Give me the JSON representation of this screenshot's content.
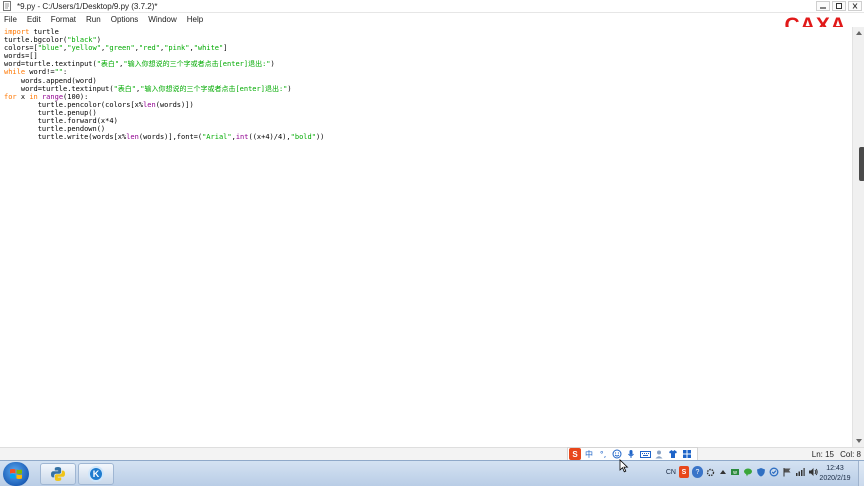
{
  "window": {
    "title": "*9.py - C:/Users/1/Desktop/9.py (3.7.2)*"
  },
  "menu": {
    "items": [
      "File",
      "Edit",
      "Format",
      "Run",
      "Options",
      "Window",
      "Help"
    ]
  },
  "overlay": {
    "logo_text": "CAXA",
    "logo_color": "#e11919"
  },
  "editor": {
    "lines": [
      [
        {
          "t": "import",
          "c": "kw"
        },
        {
          "t": " turtle",
          "c": ""
        }
      ],
      [
        {
          "t": "turtle.bgcolor(",
          "c": ""
        },
        {
          "t": "\"black\"",
          "c": "str"
        },
        {
          "t": ")",
          "c": ""
        }
      ],
      [
        {
          "t": "colors=[",
          "c": ""
        },
        {
          "t": "\"blue\"",
          "c": "str"
        },
        {
          "t": ",",
          "c": ""
        },
        {
          "t": "\"yellow\"",
          "c": "str"
        },
        {
          "t": ",",
          "c": ""
        },
        {
          "t": "\"green\"",
          "c": "str"
        },
        {
          "t": ",",
          "c": ""
        },
        {
          "t": "\"red\"",
          "c": "str"
        },
        {
          "t": ",",
          "c": ""
        },
        {
          "t": "\"pink\"",
          "c": "str"
        },
        {
          "t": ",",
          "c": ""
        },
        {
          "t": "\"white\"",
          "c": "str"
        },
        {
          "t": "]",
          "c": ""
        }
      ],
      [
        {
          "t": "words=[]",
          "c": ""
        }
      ],
      [
        {
          "t": "word=turtle.textinput(",
          "c": ""
        },
        {
          "t": "\"表白\"",
          "c": "str"
        },
        {
          "t": ",",
          "c": ""
        },
        {
          "t": "\"输入你想说的三个字或者点击[enter]退出:\"",
          "c": "str"
        },
        {
          "t": ")",
          "c": ""
        }
      ],
      [
        {
          "t": "while",
          "c": "kw"
        },
        {
          "t": " word!=",
          "c": ""
        },
        {
          "t": "\"\"",
          "c": "str"
        },
        {
          "t": ":",
          "c": ""
        }
      ],
      [
        {
          "t": "    words.append(word)",
          "c": ""
        }
      ],
      [
        {
          "t": "    word=turtle.textinput(",
          "c": ""
        },
        {
          "t": "\"表白\"",
          "c": "str"
        },
        {
          "t": ",",
          "c": ""
        },
        {
          "t": "\"输入你想说的三个字或者点击[enter]退出:\"",
          "c": "str"
        },
        {
          "t": ")",
          "c": ""
        }
      ],
      [
        {
          "t": "for",
          "c": "kw"
        },
        {
          "t": " x ",
          "c": ""
        },
        {
          "t": "in",
          "c": "kw"
        },
        {
          "t": " ",
          "c": ""
        },
        {
          "t": "range",
          "c": "bi"
        },
        {
          "t": "(100):",
          "c": ""
        }
      ],
      [
        {
          "t": "        turtle.pencolor(colors[x%",
          "c": ""
        },
        {
          "t": "len",
          "c": "bi"
        },
        {
          "t": "(words)])",
          "c": ""
        }
      ],
      [
        {
          "t": "        turtle.penup()",
          "c": ""
        }
      ],
      [
        {
          "t": "        turtle.forward(x*4)",
          "c": ""
        }
      ],
      [
        {
          "t": "        turtle.pendown()",
          "c": ""
        }
      ],
      [
        {
          "t": "        turtle.write(words[x%",
          "c": ""
        },
        {
          "t": "len",
          "c": "bi"
        },
        {
          "t": "(words)],font=(",
          "c": ""
        },
        {
          "t": "\"Arial\"",
          "c": "str"
        },
        {
          "t": ",",
          "c": ""
        },
        {
          "t": "int",
          "c": "bi"
        },
        {
          "t": "((x+4)/4),",
          "c": ""
        },
        {
          "t": "\"bold\"",
          "c": "str"
        },
        {
          "t": "))",
          "c": ""
        }
      ]
    ]
  },
  "status": {
    "line": "Ln: 15",
    "col": "Col: 8"
  },
  "ime": {
    "logo": "S",
    "mode": "中",
    "punct": "°,",
    "icons": [
      "emoji-icon",
      "mic-icon",
      "keyboard-icon",
      "user-icon",
      "skin-icon",
      "toolbox-icon"
    ]
  },
  "taskbar": {
    "k_app_label": "K",
    "tray": {
      "lang": "CN",
      "ime_logo": "S",
      "help": "?"
    },
    "clock_time": "12:43",
    "clock_date": "2020/2/19"
  }
}
